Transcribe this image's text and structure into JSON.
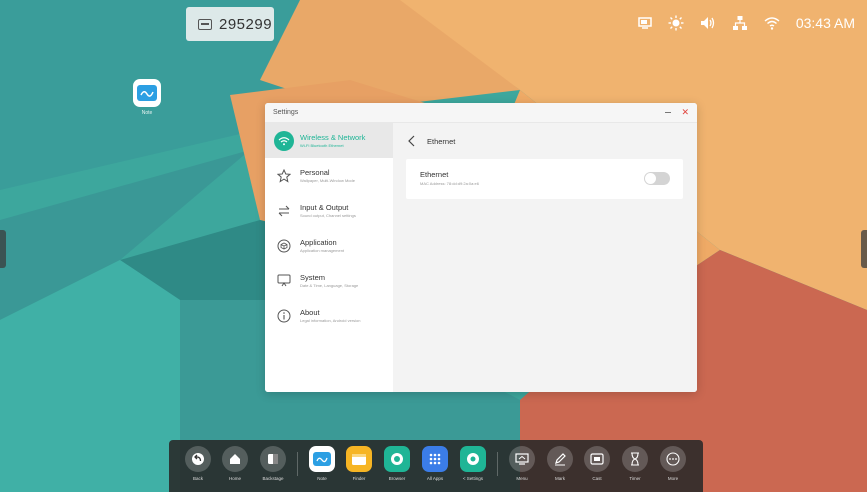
{
  "status": {
    "room_code": "295299",
    "time": "03:43 AM"
  },
  "desktop": {
    "app_label": "Note"
  },
  "settings": {
    "window_title": "Settings",
    "menu": [
      {
        "title": "Wireless & Network",
        "sub": "Wi-Fi Bluetooth Ethernet",
        "icon": "wifi-icon",
        "active": true
      },
      {
        "title": "Personal",
        "sub": "Wallpaper, Multi-Window Mode",
        "icon": "star-icon"
      },
      {
        "title": "Input & Output",
        "sub": "Sound output, Channel settings",
        "icon": "swap-arrows-icon"
      },
      {
        "title": "Application",
        "sub": "Application management",
        "icon": "box-icon"
      },
      {
        "title": "System",
        "sub": "Date & Time, Language, Storage",
        "icon": "monitor-icon"
      },
      {
        "title": "About",
        "sub": "Legal information, Android version",
        "icon": "info-icon"
      }
    ],
    "content": {
      "title": "Ethernet",
      "card_title": "Ethernet",
      "card_sub": "MAC Address: 78:dd:d9:2a:0a:e6",
      "toggle_on": false
    }
  },
  "dock": {
    "items": [
      {
        "label": "Back",
        "icon": "back-icon"
      },
      {
        "label": "Home",
        "icon": "home-icon"
      },
      {
        "label": "Backstage",
        "icon": "backstage-icon"
      },
      {
        "label": "Note",
        "icon": "note-icon"
      },
      {
        "label": "Finder",
        "icon": "folder-icon"
      },
      {
        "label": "Browser",
        "icon": "browser-icon"
      },
      {
        "label": "All Apps",
        "icon": "grid-icon"
      },
      {
        "label": "< Settings",
        "icon": "settings-icon"
      },
      {
        "label": "Menu",
        "icon": "menu-icon"
      },
      {
        "label": "Mark",
        "icon": "pen-icon"
      },
      {
        "label": "Cast",
        "icon": "cast-icon"
      },
      {
        "label": "Timer",
        "icon": "hourglass-icon"
      },
      {
        "label": "More",
        "icon": "more-icon"
      }
    ]
  },
  "colors": {
    "accent": "#1fb596",
    "wallpaper_teal": "#3fa9a0",
    "wallpaper_orange": "#eeaf6c",
    "wallpaper_red": "#cd6a52"
  }
}
